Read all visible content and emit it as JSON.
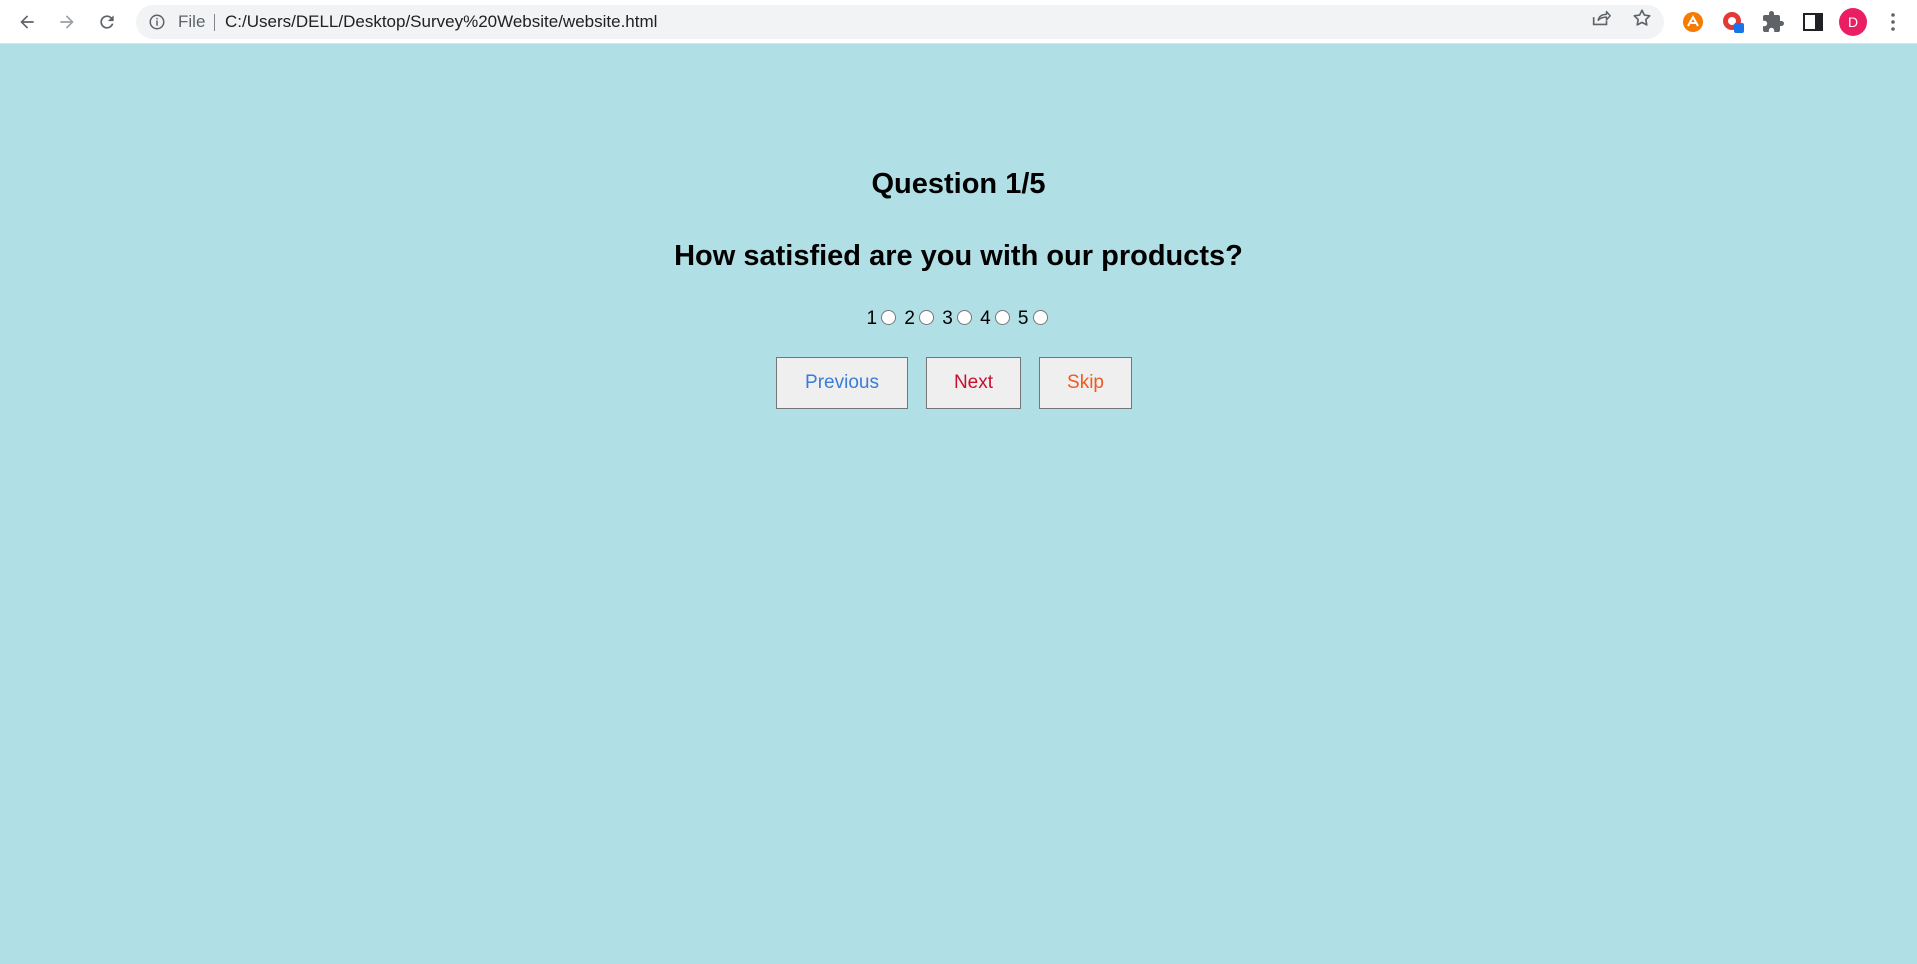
{
  "browser": {
    "scheme_label": "File",
    "url": "C:/Users/DELL/Desktop/Survey%20Website/website.html",
    "profile_initial": "D",
    "icons": {
      "back": "arrow-left-icon",
      "forward": "arrow-right-icon",
      "reload": "reload-icon",
      "site_info": "info-icon",
      "share": "share-icon",
      "bookmark": "star-icon",
      "extensions": "puzzle-icon",
      "side_panel": "side-panel-icon",
      "menu": "kebab-menu-icon"
    },
    "colors": {
      "toolbar_bg": "#ffffff",
      "omnibox_bg": "#f1f3f4",
      "avatar_bg": "#e91e63"
    }
  },
  "survey": {
    "counter": "Question 1/5",
    "question": "How satisfied are you with our products?",
    "options": [
      "1",
      "2",
      "3",
      "4",
      "5"
    ],
    "buttons": {
      "previous": "Previous",
      "next": "Next",
      "skip": "Skip"
    },
    "colors": {
      "background": "#b0dfe5",
      "previous_text": "#3a7bd5",
      "next_text": "#c8102e",
      "skip_text": "#f05a1e"
    }
  }
}
